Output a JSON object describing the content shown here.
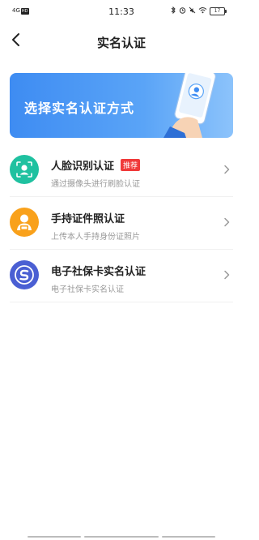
{
  "status_bar": {
    "network": "4G",
    "network_badge": "HD",
    "time": "11:33",
    "battery": "17"
  },
  "header": {
    "title": "实名认证"
  },
  "banner": {
    "text": "选择实名认证方式"
  },
  "methods": [
    {
      "title": "人脸识别认证",
      "badge": "推荐",
      "subtitle": "通过摄像头进行刷脸认证",
      "icon": "face-scan-icon",
      "color": "#1fc1a0"
    },
    {
      "title": "手持证件照认证",
      "subtitle": "上传本人手持身份证照片",
      "icon": "person-id-icon",
      "color": "#f9a11b"
    },
    {
      "title": "电子社保卡实名认证",
      "subtitle": "电子社保卡实名认证",
      "icon": "social-security-icon",
      "color": "#4a5fd3"
    }
  ],
  "colors": {
    "accent": "#3e8cf2",
    "badge": "#f03a3a"
  }
}
